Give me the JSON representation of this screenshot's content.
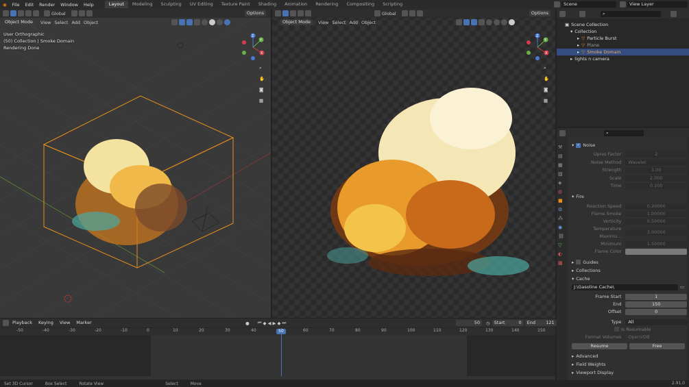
{
  "menu": [
    "File",
    "Edit",
    "Render",
    "Window",
    "Help"
  ],
  "workspace_tabs": [
    "Layout",
    "Modeling",
    "Sculpting",
    "UV Editing",
    "Texture Paint",
    "Shading",
    "Animation",
    "Rendering",
    "Compositing",
    "Scripting"
  ],
  "active_tab": "Layout",
  "scene": "Scene",
  "view_layer": "View Layer",
  "left_viewport": {
    "transform": "Global",
    "options": "Options",
    "mode": "Object Mode",
    "menus": [
      "View",
      "Select",
      "Add",
      "Object"
    ],
    "overlay_lines": [
      "User Orthographic",
      "(50) Collection | Smoke Domain",
      "Rendering Done"
    ]
  },
  "right_viewport": {
    "transform": "Global",
    "options": "Options",
    "mode": "Object Mode",
    "menus": [
      "View",
      "Select",
      "Add",
      "Object"
    ]
  },
  "gizmo": {
    "z": "Z",
    "y": "Y",
    "x": "X"
  },
  "outliner": {
    "root": "Scene Collection",
    "items": [
      {
        "label": "Collection",
        "depth": 1
      },
      {
        "label": "Particle Burst",
        "depth": 2
      },
      {
        "label": "Plane",
        "depth": 2
      },
      {
        "label": "Smoke Domain",
        "depth": 2,
        "selected": true
      },
      {
        "label": "lights n camera",
        "depth": 1
      }
    ]
  },
  "properties": {
    "noise": {
      "title": "Noise",
      "rows": [
        {
          "label": "Upres Factor",
          "value": "2"
        },
        {
          "label": "Noise Method",
          "value": "Wavelet"
        },
        {
          "label": "Strength",
          "value": "1.00"
        },
        {
          "label": "Scale",
          "value": "2.000"
        },
        {
          "label": "Time",
          "value": "0.100"
        }
      ]
    },
    "fire": {
      "title": "Fire",
      "rows": [
        {
          "label": "Reaction Speed",
          "value": "0.20000"
        },
        {
          "label": "Flame Smoke",
          "value": "1.00000"
        },
        {
          "label": "Vorticity",
          "value": "0.50000"
        },
        {
          "label": "Temperature Maximu...",
          "value": "3.00000"
        },
        {
          "label": "Minimum",
          "value": "1.50000"
        },
        {
          "label": "Flame Color",
          "value": ""
        }
      ]
    },
    "guides": "Guides",
    "collections": "Collections",
    "cache": {
      "title": "Cache",
      "path": "J:\\Gasoline Cache\\",
      "frame_start_label": "Frame Start",
      "frame_start": "1",
      "end_label": "End",
      "end": "150",
      "offset_label": "Offset",
      "offset": "0",
      "type_label": "Type",
      "type": "All",
      "resumable": "Is Resumable",
      "format_label": "Format Volumes",
      "format": "OpenVDB",
      "resume": "Resume",
      "free": "Free"
    },
    "advanced": "Advanced",
    "field_weights": "Field Weights",
    "viewport_display": "Viewport Display"
  },
  "timeline": {
    "menus": [
      "Playback",
      "Keying",
      "View",
      "Marker"
    ],
    "current": "50",
    "start_label": "Start",
    "start": "0",
    "end_label": "End",
    "end": "121",
    "ticks": [
      "-50",
      "-40",
      "-30",
      "-20",
      "-10",
      "0",
      "10",
      "20",
      "30",
      "40",
      "50",
      "60",
      "70",
      "80",
      "90",
      "100",
      "110",
      "120",
      "130",
      "140",
      "150"
    ]
  },
  "status": {
    "items": [
      "Set 3D Cursor",
      "Box Select",
      "Rotate View",
      "Select",
      "Move"
    ],
    "version": "2.91.0"
  }
}
